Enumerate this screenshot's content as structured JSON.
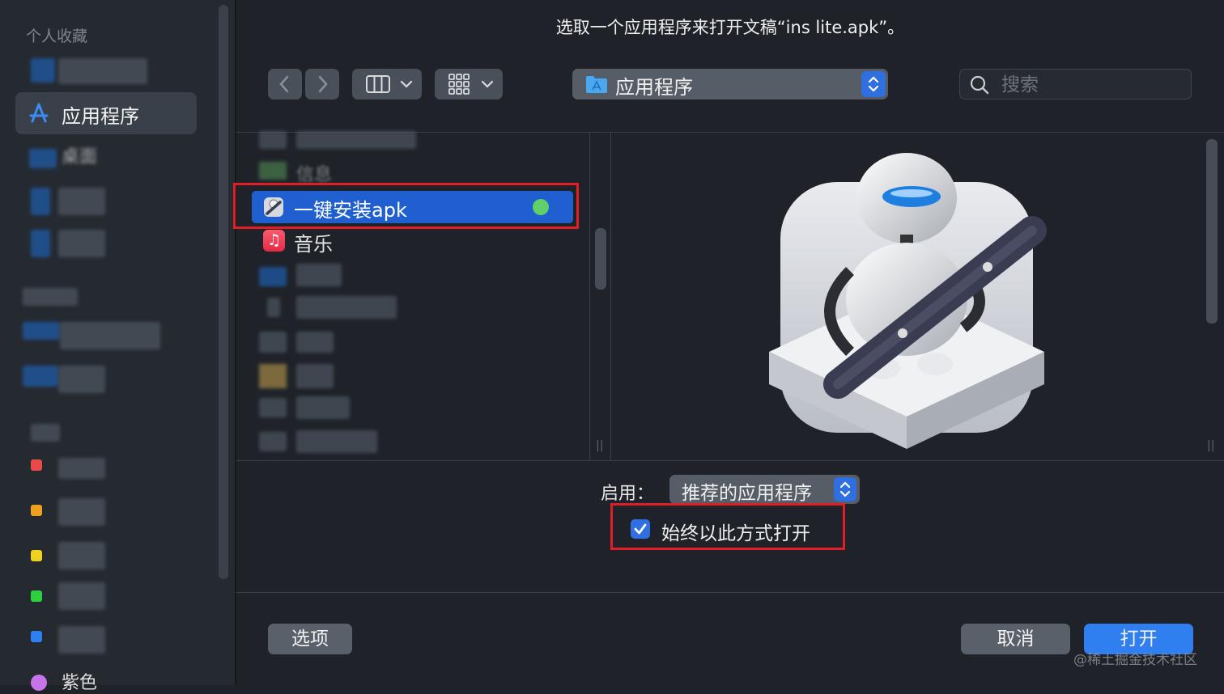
{
  "dialog": {
    "title": "选取一个应用程序来打开文稿“ins lite.apk”。"
  },
  "sidebar": {
    "section_title": "个人收藏",
    "selected_item": "应用程序",
    "partial_item": "桌面",
    "tag_item": "紫色"
  },
  "toolbar": {
    "location": "应用程序",
    "search_placeholder": "搜索"
  },
  "file_list": {
    "partial_item": "信息",
    "selected_item": "一键安装apk",
    "next_item": "音乐"
  },
  "options": {
    "enable_label": "启用：",
    "enable_value": "推荐的应用程序",
    "always_open_label": "始终以此方式打开",
    "always_open_checked": true
  },
  "buttons": {
    "options": "选项",
    "cancel": "取消",
    "open": "打开"
  },
  "watermark": "@稀土掘金技术社区",
  "colors": {
    "accent": "#2f7ff0",
    "selection": "#1f5fd0",
    "highlight_box": "#e11d26",
    "status_dot": "#5fd06a"
  }
}
